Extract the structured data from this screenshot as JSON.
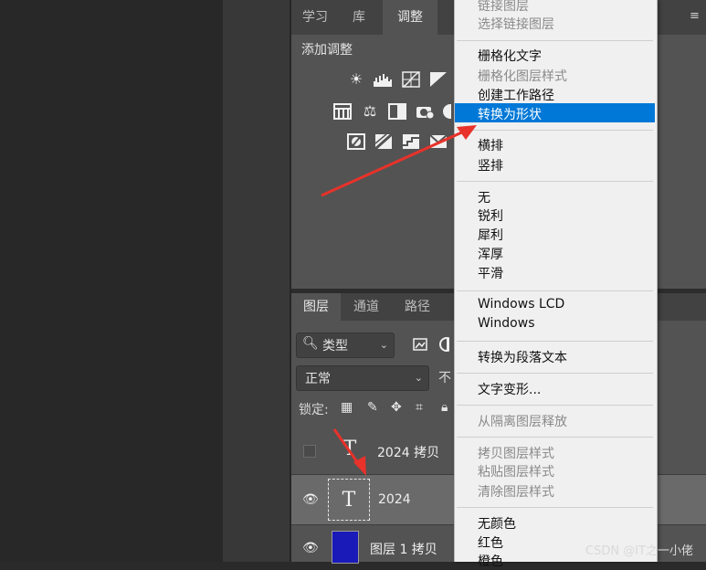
{
  "panel_tabs": {
    "learn": "学习",
    "library": "库",
    "adjust": "调整"
  },
  "adjust": {
    "title": "添加调整"
  },
  "layers_tabs": {
    "layers": "图层",
    "channels": "通道",
    "paths": "路径"
  },
  "filter": {
    "label": "类型"
  },
  "blend": {
    "mode": "正常",
    "opacity_label_partial": "不"
  },
  "lock": {
    "label": "锁定:"
  },
  "layers": [
    {
      "name": "2024 拷贝",
      "visible": false,
      "kind": "text"
    },
    {
      "name": "2024",
      "visible": true,
      "kind": "text",
      "selected": true
    },
    {
      "name": "图层 1 拷贝",
      "visible": true,
      "kind": "pixel",
      "color": "#1a1ab8"
    }
  ],
  "context_menu": {
    "items": [
      {
        "label": "链接图层",
        "disabled": true
      },
      {
        "label": "选择链接图层",
        "disabled": true
      },
      {
        "label": "栅格化文字",
        "disabled": false
      },
      {
        "label": "栅格化图层样式",
        "disabled": true
      },
      {
        "label": "创建工作路径",
        "disabled": false
      },
      {
        "label": "转换为形状",
        "disabled": false,
        "highlighted": true
      },
      {
        "label": "横排",
        "disabled": false
      },
      {
        "label": "竖排",
        "disabled": false
      },
      {
        "label": "无",
        "disabled": false
      },
      {
        "label": "锐利",
        "disabled": false
      },
      {
        "label": "犀利",
        "disabled": false
      },
      {
        "label": "浑厚",
        "disabled": false
      },
      {
        "label": "平滑",
        "disabled": false
      },
      {
        "label": "Windows LCD",
        "disabled": false
      },
      {
        "label": "Windows",
        "disabled": false
      },
      {
        "label": "转换为段落文本",
        "disabled": false
      },
      {
        "label": "文字变形...",
        "disabled": false
      },
      {
        "label": "从隔离图层释放",
        "disabled": true
      },
      {
        "label": "拷贝图层样式",
        "disabled": true
      },
      {
        "label": "粘贴图层样式",
        "disabled": true
      },
      {
        "label": "清除图层样式",
        "disabled": true
      },
      {
        "label": "无颜色",
        "disabled": false
      },
      {
        "label": "红色",
        "disabled": false
      },
      {
        "label": "橙色",
        "disabled": false
      }
    ]
  },
  "watermark": "CSDN @IT之一小佬",
  "colors": {
    "highlight": "#0078d7",
    "arrow": "#e8322a",
    "panel": "#535353"
  }
}
